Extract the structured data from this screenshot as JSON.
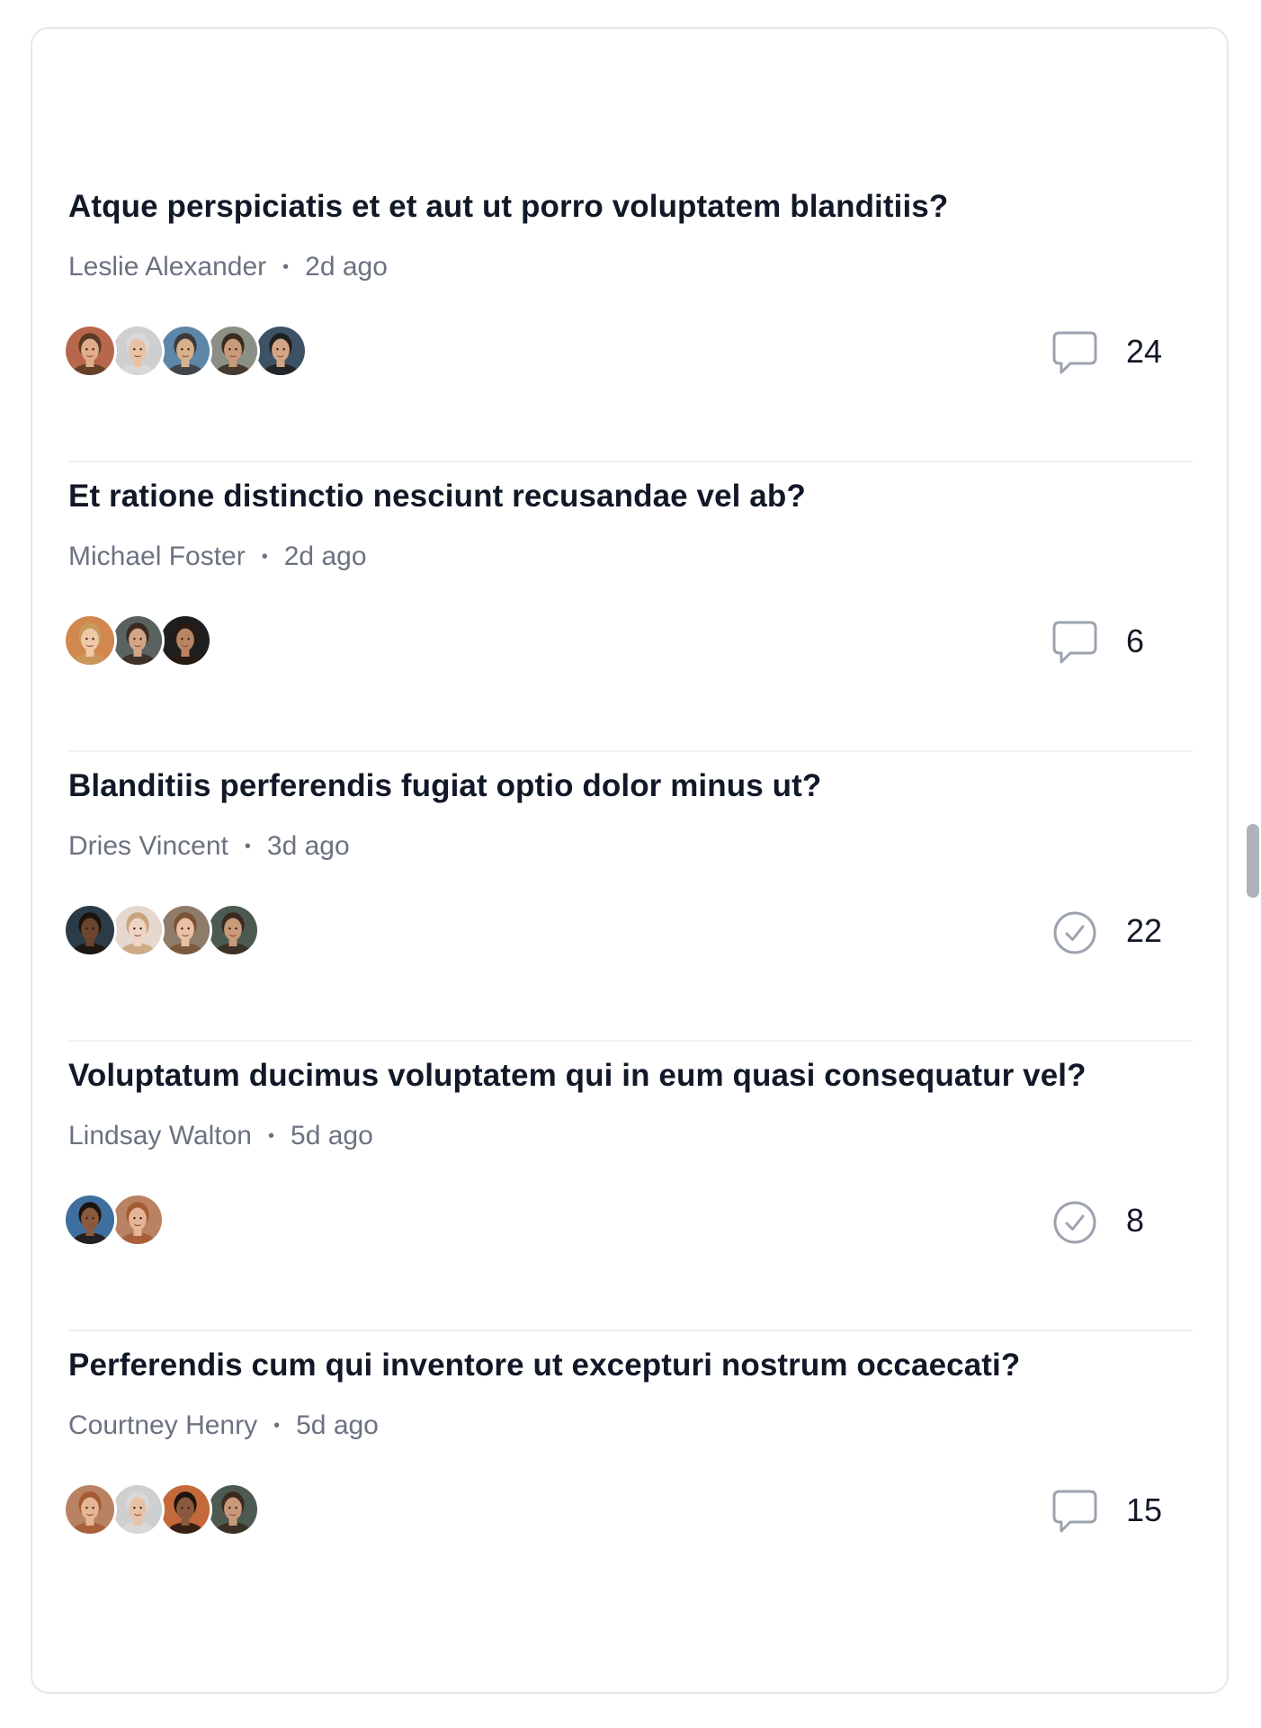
{
  "discussions": [
    {
      "title": "Atque perspiciatis et et aut ut porro voluptatem blanditiis?",
      "author": "Leslie Alexander",
      "time": "2d ago",
      "status_icon": "chat-bubble-icon",
      "count": "24",
      "avatars": [
        {
          "skin": "#e0ac8a",
          "hair": "#5b3a24",
          "bg": "#b7674c"
        },
        {
          "skin": "#e8c2a6",
          "hair": "#d9d9d9",
          "bg": "#cfcfcf"
        },
        {
          "skin": "#d9b08c",
          "hair": "#3b3b3b",
          "bg": "#5e86a8"
        },
        {
          "skin": "#c99a7a",
          "hair": "#3a2a20",
          "bg": "#8c8f86"
        },
        {
          "skin": "#d3a585",
          "hair": "#1f1f1f",
          "bg": "#3e5266"
        }
      ]
    },
    {
      "title": "Et ratione distinctio nesciunt recusandae vel ab?",
      "author": "Michael Foster",
      "time": "2d ago",
      "status_icon": "chat-bubble-icon",
      "count": "6",
      "avatars": [
        {
          "skin": "#efc8a8",
          "hair": "#c89a5a",
          "bg": "#d2874e"
        },
        {
          "skin": "#d3a585",
          "hair": "#3a2a20",
          "bg": "#5a6260"
        },
        {
          "skin": "#b98462",
          "hair": "#2a1a12",
          "bg": "#1e1e1e"
        }
      ]
    },
    {
      "title": "Blanditiis perferendis fugiat optio dolor minus ut?",
      "author": "Dries Vincent",
      "time": "3d ago",
      "status_icon": "check-circle-icon",
      "count": "22",
      "avatars": [
        {
          "skin": "#6b4530",
          "hair": "#1a120c",
          "bg": "#2c3b48"
        },
        {
          "skin": "#efd4c4",
          "hair": "#c9a27a",
          "bg": "#e6d8cf"
        },
        {
          "skin": "#e8c0a4",
          "hair": "#7a5332",
          "bg": "#8f7b6a"
        },
        {
          "skin": "#c99a7a",
          "hair": "#3a2a20",
          "bg": "#4d5a52"
        }
      ]
    },
    {
      "title": "Voluptatum ducimus voluptatem qui in eum quasi consequatur vel?",
      "author": "Lindsay Walton",
      "time": "5d ago",
      "status_icon": "check-circle-icon",
      "count": "8",
      "avatars": [
        {
          "skin": "#8a5a3e",
          "hair": "#1e140e",
          "bg": "#3f6f9e"
        },
        {
          "skin": "#e5b596",
          "hair": "#a65a32",
          "bg": "#b88263"
        }
      ]
    },
    {
      "title": "Perferendis cum qui inventore ut excepturi nostrum occaecati?",
      "author": "Courtney Henry",
      "time": "5d ago",
      "status_icon": "chat-bubble-icon",
      "count": "15",
      "avatars": [
        {
          "skin": "#e5b596",
          "hair": "#a65a32",
          "bg": "#b88263"
        },
        {
          "skin": "#e8c2a6",
          "hair": "#d9d9d9",
          "bg": "#cfcfcf"
        },
        {
          "skin": "#8a5a3e",
          "hair": "#1e140e",
          "bg": "#c46a3a"
        },
        {
          "skin": "#c99a7a",
          "hair": "#3a2a20",
          "bg": "#4d5a52"
        }
      ]
    }
  ],
  "colors": {
    "title": "#111827",
    "meta": "#6b7280",
    "icon_stroke": "#9ca3af",
    "divider": "#f0f1f3",
    "border": "#e5e7eb"
  }
}
